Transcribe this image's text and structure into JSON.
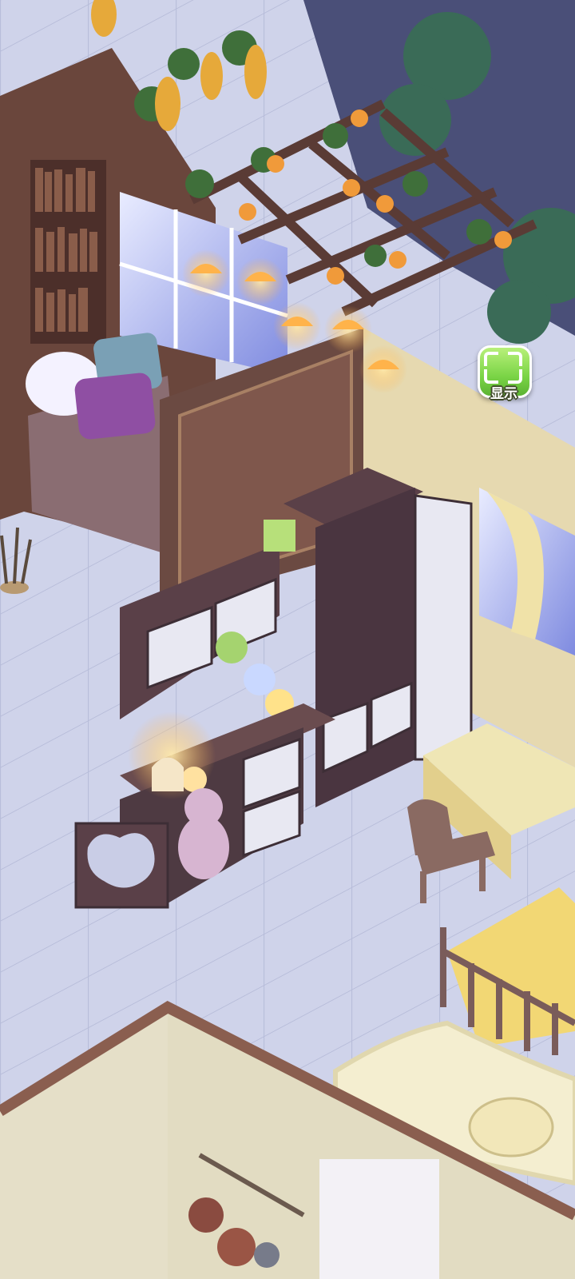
{
  "hud": {
    "display_button_label": "显示",
    "display_button_icon": "expand-frame-icon"
  },
  "scene": {
    "name": "isometric-bedroom",
    "colors": {
      "floor": "#cfd3ea",
      "floor_grout": "#b7bcd9",
      "wood_dark": "#5a3b35",
      "wood_light": "#8b5e4f",
      "wall_cream": "#e6d9b0",
      "window_glow": "#b9c8ff",
      "lamp_orange": "#ffb34a",
      "leaf_green": "#3f6f3a",
      "cabinet_white": "#e8e8f2",
      "quilt_yellow": "#f2d774"
    }
  }
}
